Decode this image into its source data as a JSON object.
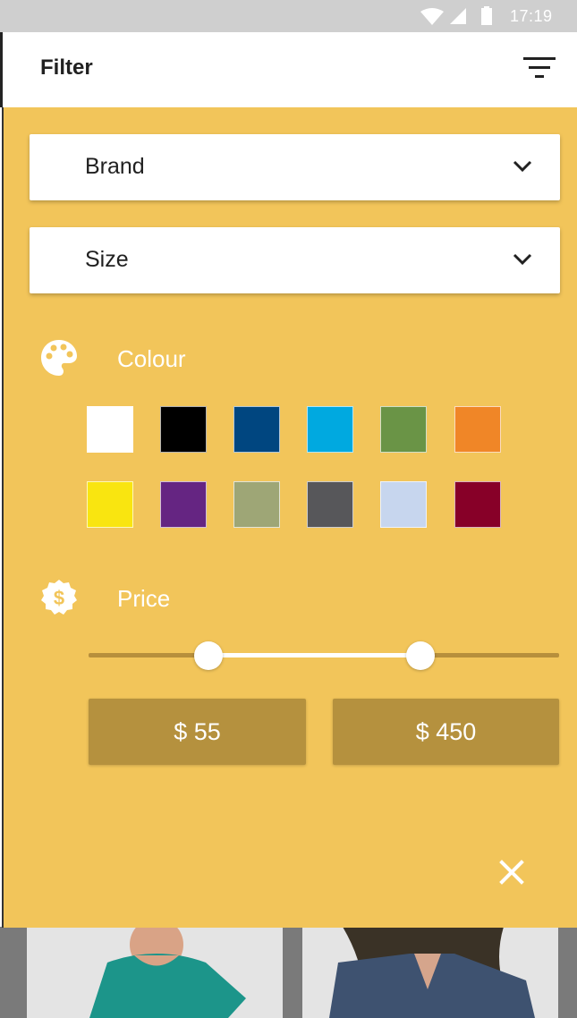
{
  "status_bar": {
    "time": "17:19",
    "icons": [
      "wifi-icon",
      "signal-icon",
      "battery-icon"
    ]
  },
  "app_bar": {
    "title": "Filter",
    "filter_icon": "filter-list-icon"
  },
  "filters": {
    "brand_label": "Brand",
    "size_label": "Size",
    "colour_title": "Colour",
    "colour_icon": "palette-icon",
    "colours": [
      "#ffffff",
      "#000000",
      "#004680",
      "#00a9e0",
      "#6a9446",
      "#f08627",
      "#f9e510",
      "#652582",
      "#9ea676",
      "#57575a",
      "#c7d6ee",
      "#870028"
    ],
    "price_title": "Price",
    "price_icon": "dollar-badge-icon",
    "price_min": "$ 55",
    "price_max": "$ 450",
    "range_min_fraction": 0.255,
    "range_max_fraction": 0.705
  },
  "close_icon": "close-icon",
  "theme": {
    "panel_bg": "#f2c55a",
    "price_box_bg": "#b5913e",
    "status_bar_bg": "#cfcfcf"
  }
}
